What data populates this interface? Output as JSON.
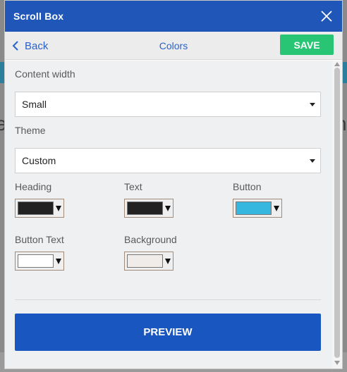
{
  "window": {
    "title": "Scroll Box"
  },
  "nav": {
    "back_label": "Back",
    "title": "Colors",
    "save_label": "SAVE"
  },
  "form": {
    "content_width": {
      "label": "Content width",
      "value": "Small"
    },
    "theme": {
      "label": "Theme",
      "value": "Custom"
    },
    "colors": {
      "heading": {
        "label": "Heading",
        "value": "#222222"
      },
      "text": {
        "label": "Text",
        "value": "#222222"
      },
      "button": {
        "label": "Button",
        "value": "#35b7e0"
      },
      "button_text": {
        "label": "Button Text",
        "value": "#ffffff"
      },
      "background": {
        "label": "Background",
        "value": "#efecea"
      }
    }
  },
  "actions": {
    "preview_label": "PREVIEW"
  },
  "theme_colors": {
    "accent": "#1f56b8",
    "save": "#27c574",
    "link": "#2a62c9"
  }
}
